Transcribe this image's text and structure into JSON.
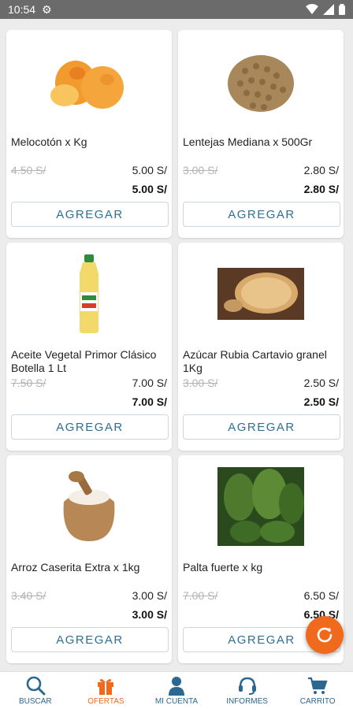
{
  "status_bar": {
    "time": "10:54"
  },
  "products": [
    {
      "name": "Melocotón x Kg",
      "old_price": "4.50 S/",
      "price": "5.00 S/",
      "final_price": "5.00 S/",
      "image": "peach-image"
    },
    {
      "name": "Lentejas Mediana x 500Gr",
      "old_price": "3.00 S/",
      "price": "2.80 S/",
      "final_price": "2.80 S/",
      "image": "lentils-image"
    },
    {
      "name": "Aceite Vegetal Primor Clásico Botella 1 Lt",
      "old_price": "7.50 S/",
      "price": "7.00 S/",
      "final_price": "7.00 S/",
      "image": "oil-bottle-image"
    },
    {
      "name": "Azúcar Rubia Cartavio granel 1Kg",
      "old_price": "3.00 S/",
      "price": "2.50 S/",
      "final_price": "2.50 S/",
      "image": "sugar-image"
    },
    {
      "name": "Arroz Caserita Extra x 1kg",
      "old_price": "3.40 S/",
      "price": "3.00 S/",
      "final_price": "3.00 S/",
      "image": "rice-sack-image"
    },
    {
      "name": "Palta fuerte x kg",
      "old_price": "7.00 S/",
      "price": "6.50 S/",
      "final_price": "6.50 S/",
      "image": "avocado-image"
    }
  ],
  "add_button_label": "AGREGAR",
  "bottom_nav": [
    {
      "label": "BUSCAR",
      "icon": "search-icon",
      "active": false
    },
    {
      "label": "OFERTAS",
      "icon": "gift-icon",
      "active": true
    },
    {
      "label": "MI CUENTA",
      "icon": "user-icon",
      "active": false
    },
    {
      "label": "INFORMES",
      "icon": "headset-icon",
      "active": false
    },
    {
      "label": "CARRITO",
      "icon": "cart-icon",
      "active": false
    }
  ],
  "colors": {
    "accent": "#ef6a1d",
    "primary": "#2b6891"
  }
}
